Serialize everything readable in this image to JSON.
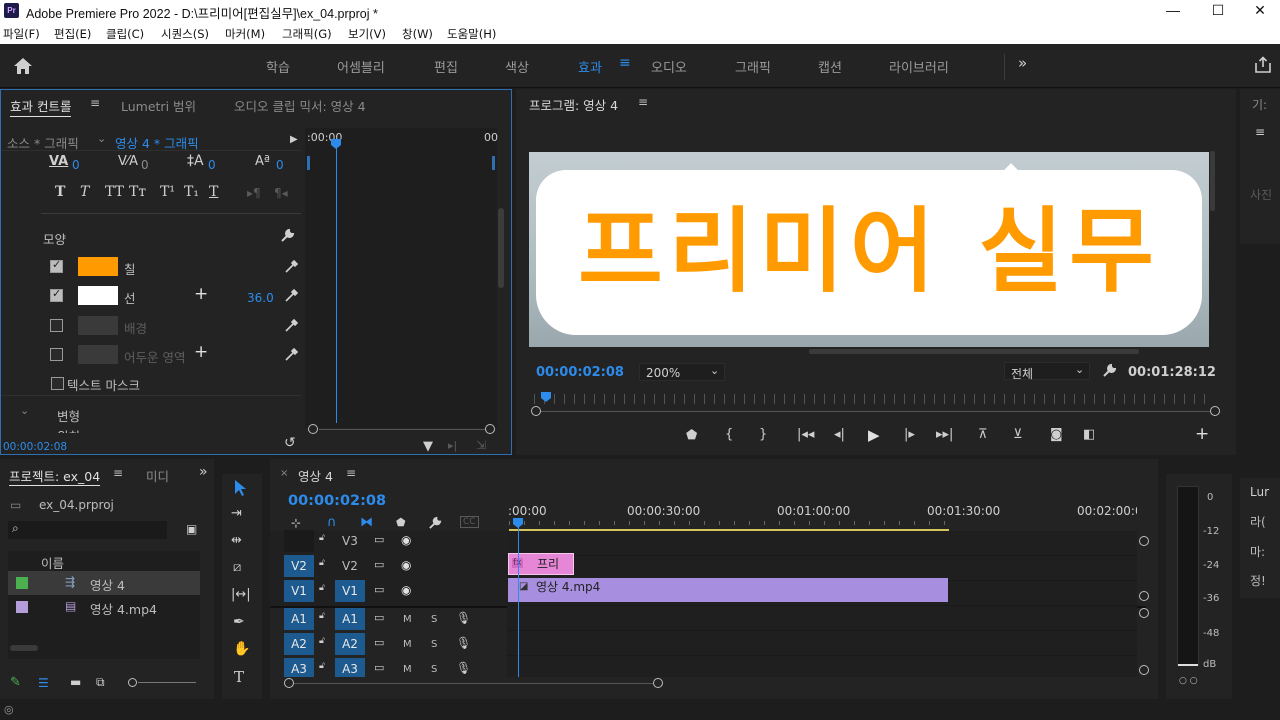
{
  "titlebar": {
    "app_icon": "Pr",
    "title": "Adobe Premiere Pro 2022 - D:\\프리미어[편집실무]\\ex_04.prproj *",
    "minimize": "—",
    "maximize": "☐",
    "close": "✕"
  },
  "menu": [
    "파일(F)",
    "편집(E)",
    "클립(C)",
    "시퀀스(S)",
    "마커(M)",
    "그래픽(G)",
    "보기(V)",
    "창(W)",
    "도움말(H)"
  ],
  "workspaces": {
    "tabs": [
      "학습",
      "어셈블리",
      "편집",
      "색상",
      "효과",
      "오디오",
      "그래픽",
      "캡션",
      "라이브러리"
    ],
    "active": "효과",
    "more": "»"
  },
  "effect_controls": {
    "tab_effect": "효과 컨트롤",
    "tab_lumetri": "Lumetri 범위",
    "tab_audio_mixer": "오디오 클립 믹서: 영상 4",
    "source": "소스 * 그래픽",
    "target": "영상 4 * 그래픽",
    "ruler_start": ":00:00",
    "ruler_end": "00",
    "kerning_value": "0",
    "tracking_value": "0",
    "leading_value": "0",
    "baseline_value": "0",
    "type_buttons": [
      "T",
      "T",
      "TT",
      "Tт",
      "T¹",
      "T₁",
      "T"
    ],
    "appearance_label": "모양",
    "fill_label": "칠",
    "stroke_label": "선",
    "stroke_value": "36.0",
    "background_label": "배경",
    "shadow_label": "어두운 영역",
    "text_mask_label": "텍스트 마스크",
    "transform_label": "변형",
    "position_label": "위치",
    "timecode": "00:00:02:08",
    "fill_color": "#ff9a00",
    "stroke_color": "#ffffff"
  },
  "program": {
    "title": "프로그램: 영상 4",
    "title_text": "프리미어 실무",
    "timecode": "00:00:02:08",
    "zoom": "200%",
    "fit": "전체",
    "duration": "00:01:28:12",
    "accent": "#2d8ceb"
  },
  "right_panel": {
    "tabs_top": [
      "기:",
      "사진"
    ],
    "tabs_bottom": [
      "Lur",
      "라(",
      "마:",
      "정!"
    ]
  },
  "project": {
    "title": "프로젝트: ex_04",
    "tab_media": "미디",
    "file": "ex_04.prproj",
    "column_name": "이름",
    "items": [
      {
        "name": "영상 4",
        "color": "#4caf50",
        "type": "sequence"
      },
      {
        "name": "영상 4.mp4",
        "color": "#b39ddb",
        "type": "clip"
      }
    ]
  },
  "timeline": {
    "title": "영상 4",
    "timecode": "00:00:02:08",
    "ruler": [
      ":00:00",
      "00:00:30:00",
      "00:01:00:00",
      "00:01:30:00",
      "00:02:00:0("
    ],
    "video_tracks": [
      {
        "toggle": "",
        "name": "V3"
      },
      {
        "toggle": "V2",
        "name": "V2"
      },
      {
        "toggle": "V1",
        "name": "V1"
      }
    ],
    "audio_tracks": [
      {
        "toggle": "A1",
        "name": "A1"
      },
      {
        "toggle": "A2",
        "name": "A2"
      },
      {
        "toggle": "A3",
        "name": "A3"
      }
    ],
    "graphic_clip": "프리",
    "video_clip": "영상 4.mp4",
    "mute": "M",
    "solo": "S"
  },
  "meter": {
    "labels": [
      "0",
      "-12",
      "-24",
      "-36",
      "-48",
      "dB"
    ]
  }
}
